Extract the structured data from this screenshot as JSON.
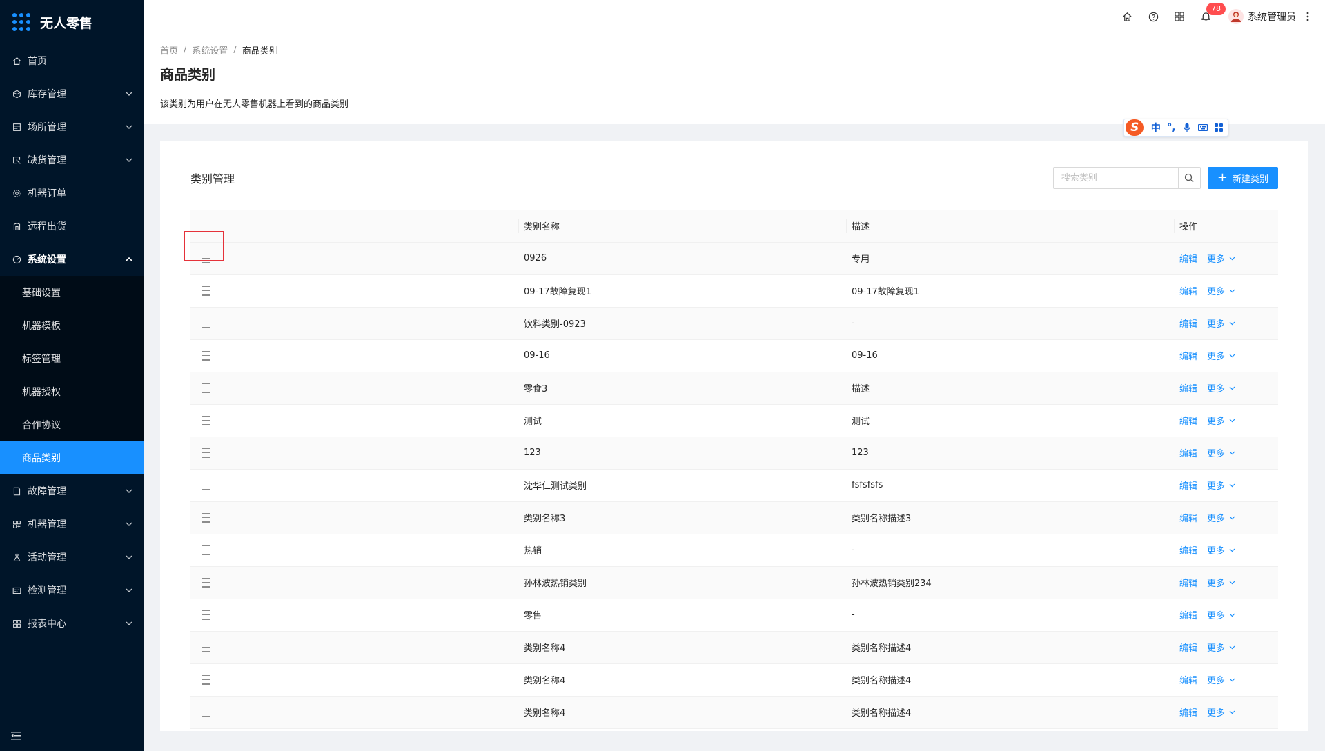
{
  "app": {
    "title": "无人零售"
  },
  "sidebar": {
    "items": [
      {
        "key": "home",
        "label": "首页",
        "icon": "home-icon",
        "chevron": false
      },
      {
        "key": "inventory",
        "label": "库存管理",
        "icon": "cube-icon",
        "chevron": true
      },
      {
        "key": "venue",
        "label": "场所管理",
        "icon": "building-icon",
        "chevron": true
      },
      {
        "key": "shortage",
        "label": "缺货管理",
        "icon": "shortage-icon",
        "chevron": true
      },
      {
        "key": "orders",
        "label": "机器订单",
        "icon": "settings-cog-icon",
        "chevron": false
      },
      {
        "key": "remote",
        "label": "远程出货",
        "icon": "remote-icon",
        "chevron": false
      },
      {
        "key": "system",
        "label": "系统设置",
        "icon": "dashboard-icon",
        "chevron": true,
        "open": true
      }
    ],
    "sub_items": [
      {
        "key": "basic",
        "label": "基础设置"
      },
      {
        "key": "template",
        "label": "机器模板"
      },
      {
        "key": "tags",
        "label": "标签管理"
      },
      {
        "key": "auth",
        "label": "机器授权"
      },
      {
        "key": "agreement",
        "label": "合作协议"
      },
      {
        "key": "category",
        "label": "商品类别",
        "active": true
      }
    ],
    "items_after": [
      {
        "key": "fault",
        "label": "故障管理",
        "icon": "document-icon",
        "chevron": true
      },
      {
        "key": "machine",
        "label": "机器管理",
        "icon": "machine-icon",
        "chevron": true
      },
      {
        "key": "activity",
        "label": "活动管理",
        "icon": "activity-icon",
        "chevron": true
      },
      {
        "key": "inspect",
        "label": "检测管理",
        "icon": "calendar-icon",
        "chevron": true
      },
      {
        "key": "report",
        "label": "报表中心",
        "icon": "grid-icon",
        "chevron": true
      }
    ]
  },
  "header": {
    "notifications_count": "78",
    "username": "系统管理员"
  },
  "breadcrumb": [
    "首页",
    "系统设置",
    "商品类别"
  ],
  "page": {
    "title": "商品类别",
    "description": "该类别为用户在无人零售机器上看到的商品类别"
  },
  "ime": {
    "lang": "中",
    "punct": "°,"
  },
  "card": {
    "title": "类别管理",
    "search_placeholder": "搜索类别",
    "new_button": "新建类别"
  },
  "table": {
    "columns": [
      "类别名称",
      "描述",
      "操作"
    ],
    "edit_label": "编辑",
    "more_label": "更多",
    "rows": [
      {
        "name": "0926",
        "desc": "专用"
      },
      {
        "name": "09-17故障复现1",
        "desc": "09-17故障复现1"
      },
      {
        "name": "饮料类别-0923",
        "desc": "-"
      },
      {
        "name": "09-16",
        "desc": "09-16"
      },
      {
        "name": "零食3",
        "desc": "描述"
      },
      {
        "name": "测试",
        "desc": "测试"
      },
      {
        "name": "123",
        "desc": "123"
      },
      {
        "name": "沈华仁测试类别",
        "desc": "fsfsfsfs"
      },
      {
        "name": "类别名称3",
        "desc": "类别名称描述3"
      },
      {
        "name": "热销",
        "desc": "-"
      },
      {
        "name": "孙林波热销类别",
        "desc": "孙林波热销类别234"
      },
      {
        "name": "零售",
        "desc": "-"
      },
      {
        "name": "类别名称4",
        "desc": "类别名称描述4"
      },
      {
        "name": "类别名称4",
        "desc": "类别名称描述4"
      },
      {
        "name": "类别名称4",
        "desc": "类别名称描述4"
      }
    ]
  },
  "colors": {
    "primary": "#1890ff",
    "sider_bg": "#001529",
    "badge": "#ff4d4f",
    "highlight": "#e5323a"
  }
}
